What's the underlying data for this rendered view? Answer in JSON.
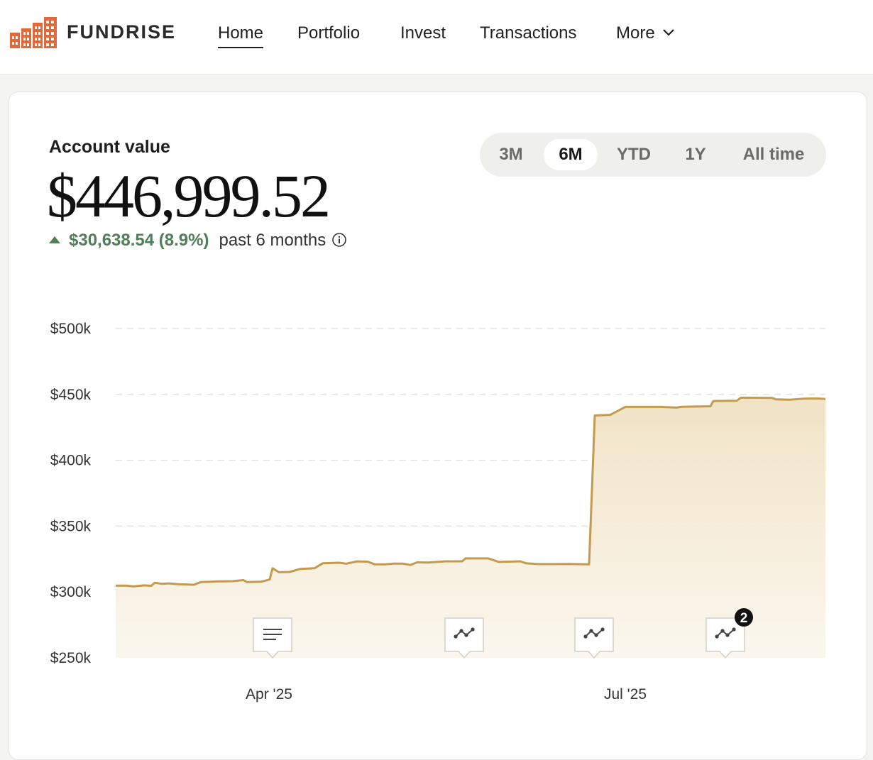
{
  "brand": {
    "name": "FUNDRISE",
    "logo_icon": "building-logo-icon",
    "color": "#e06a3c"
  },
  "nav": {
    "items": [
      {
        "label": "Home",
        "active": true
      },
      {
        "label": "Portfolio",
        "active": false
      },
      {
        "label": "Invest",
        "active": false
      },
      {
        "label": "Transactions",
        "active": false
      },
      {
        "label": "More",
        "active": false
      }
    ]
  },
  "account": {
    "label": "Account value",
    "value": "$446,999.52",
    "change": "$30,638.54 (8.9%)",
    "period": "past 6 months",
    "positive_color": "#4f7e58"
  },
  "range_selector": {
    "options": [
      "3M",
      "6M",
      "YTD",
      "1Y",
      "All time"
    ],
    "selected": "6M"
  },
  "chart_data": {
    "type": "area",
    "title": "",
    "xlabel": "",
    "ylabel": "",
    "ylim": [
      250000,
      500000
    ],
    "y_ticks": [
      "$250k",
      "$300k",
      "$350k",
      "$400k",
      "$450k",
      "$500k"
    ],
    "y_tick_values": [
      250000,
      300000,
      350000,
      400000,
      450000,
      500000
    ],
    "x_ticks": [
      {
        "label": "Apr '25",
        "t": 0.216
      },
      {
        "label": "Jul '25",
        "t": 0.718
      }
    ],
    "grid": true,
    "line_color": "#c39a4e",
    "fill_color": "#f2e6cd",
    "series": [
      {
        "points": [
          [
            0.0,
            304800
          ],
          [
            0.015,
            304800
          ],
          [
            0.025,
            304200
          ],
          [
            0.04,
            305000
          ],
          [
            0.05,
            304700
          ],
          [
            0.055,
            307000
          ],
          [
            0.065,
            306200
          ],
          [
            0.075,
            306500
          ],
          [
            0.09,
            305800
          ],
          [
            0.11,
            305500
          ],
          [
            0.12,
            307500
          ],
          [
            0.135,
            307800
          ],
          [
            0.14,
            308000
          ],
          [
            0.165,
            308200
          ],
          [
            0.18,
            309000
          ],
          [
            0.185,
            307500
          ],
          [
            0.205,
            307800
          ],
          [
            0.212,
            308800
          ],
          [
            0.217,
            309500
          ],
          [
            0.221,
            318000
          ],
          [
            0.23,
            315000
          ],
          [
            0.245,
            315200
          ],
          [
            0.26,
            317500
          ],
          [
            0.28,
            318000
          ],
          [
            0.292,
            321800
          ],
          [
            0.315,
            322200
          ],
          [
            0.325,
            321500
          ],
          [
            0.34,
            323200
          ],
          [
            0.355,
            323000
          ],
          [
            0.365,
            321000
          ],
          [
            0.38,
            321000
          ],
          [
            0.392,
            321500
          ],
          [
            0.405,
            321500
          ],
          [
            0.415,
            320500
          ],
          [
            0.425,
            322500
          ],
          [
            0.44,
            322300
          ],
          [
            0.465,
            323300
          ],
          [
            0.488,
            323300
          ],
          [
            0.493,
            325500
          ],
          [
            0.525,
            325500
          ],
          [
            0.54,
            322800
          ],
          [
            0.57,
            323300
          ],
          [
            0.578,
            321800
          ],
          [
            0.595,
            321200
          ],
          [
            0.62,
            321200
          ],
          [
            0.64,
            321300
          ],
          [
            0.667,
            321000
          ],
          [
            0.675,
            434000
          ],
          [
            0.697,
            434500
          ],
          [
            0.718,
            440500
          ],
          [
            0.768,
            440500
          ],
          [
            0.79,
            440000
          ],
          [
            0.798,
            440600
          ],
          [
            0.838,
            441000
          ],
          [
            0.842,
            445000
          ],
          [
            0.875,
            445200
          ],
          [
            0.881,
            447500
          ],
          [
            0.925,
            447300
          ],
          [
            0.93,
            446300
          ],
          [
            0.95,
            446000
          ],
          [
            0.97,
            446800
          ],
          [
            0.99,
            446900
          ],
          [
            1.0,
            446500
          ]
        ]
      }
    ],
    "markers": [
      {
        "icon": "notes-icon",
        "t": 0.221,
        "badge": ""
      },
      {
        "icon": "trend-line-icon",
        "t": 0.491,
        "badge": ""
      },
      {
        "icon": "trend-line-icon",
        "t": 0.674,
        "badge": ""
      },
      {
        "icon": "trend-line-icon",
        "t": 0.859,
        "badge": "2"
      }
    ]
  }
}
